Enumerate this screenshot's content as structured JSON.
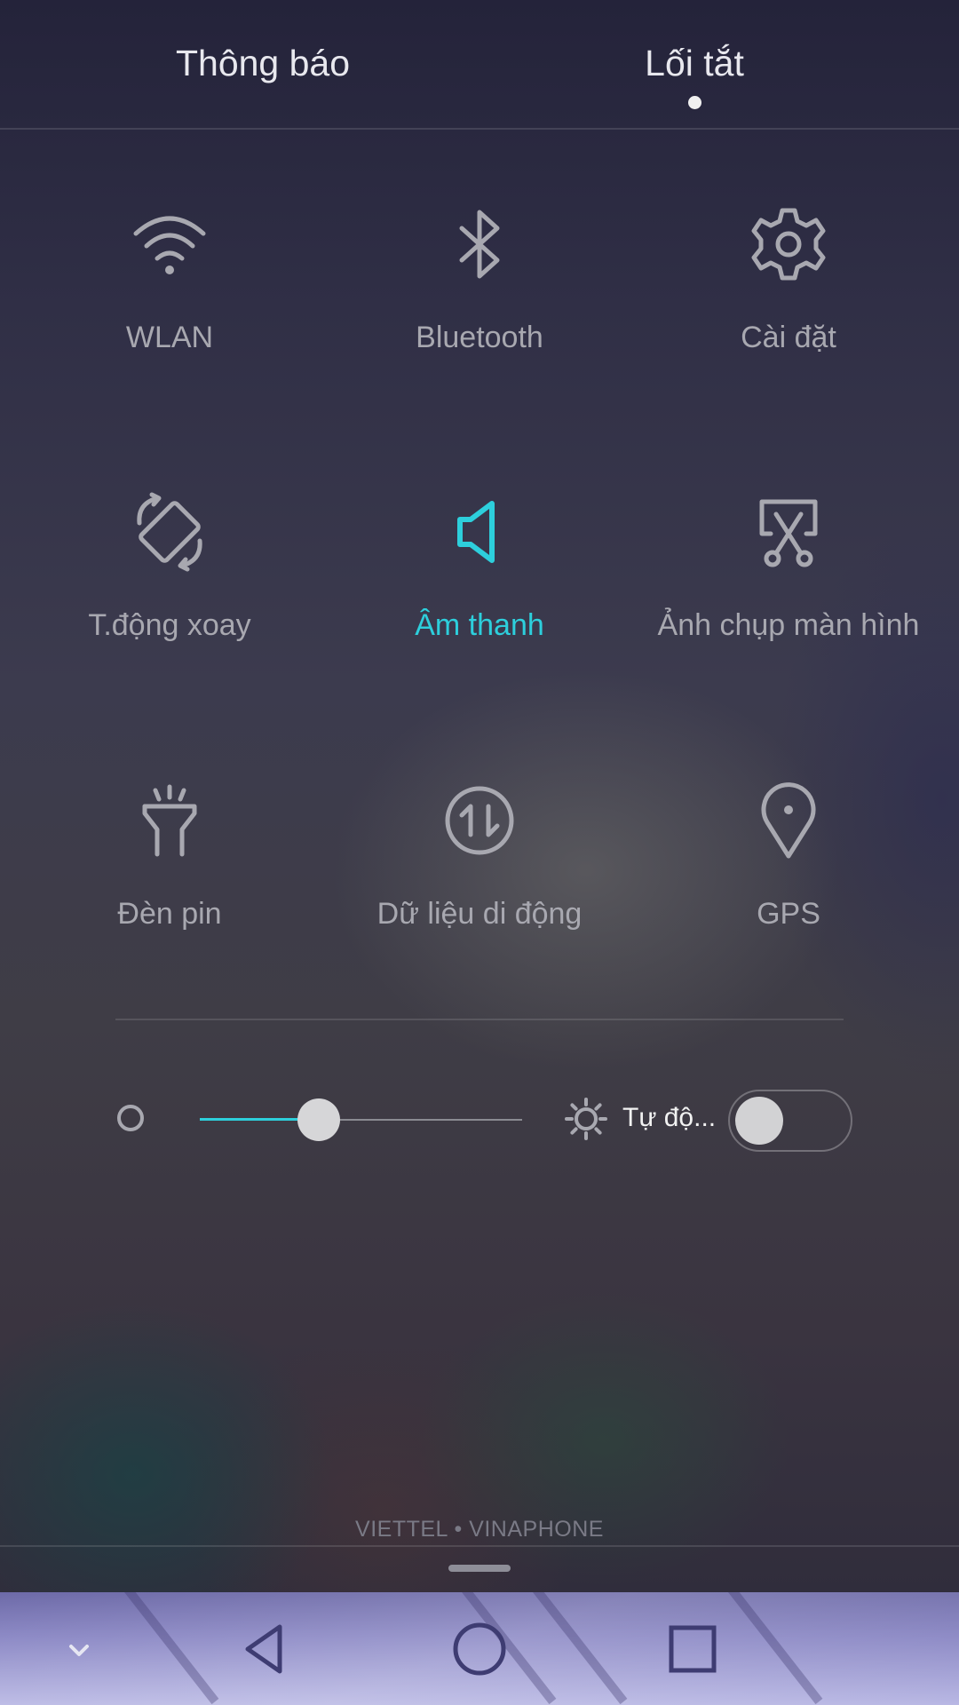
{
  "tabs": {
    "notifications_label": "Thông báo",
    "shortcuts_label": "Lối tắt",
    "active": "shortcuts"
  },
  "tiles": [
    {
      "label": "WLAN",
      "icon": "wifi-icon",
      "active": false
    },
    {
      "label": "Bluetooth",
      "icon": "bluetooth-icon",
      "active": false
    },
    {
      "label": "Cài đặt",
      "icon": "gear-icon",
      "active": false
    },
    {
      "label": "T.động xoay",
      "icon": "auto-rotate-icon",
      "active": false
    },
    {
      "label": "Âm thanh",
      "icon": "speaker-icon",
      "active": true
    },
    {
      "label": "Ảnh chụp màn hình",
      "icon": "screenshot-scissors-icon",
      "active": false
    },
    {
      "label": "Đèn pin",
      "icon": "flashlight-icon",
      "active": false
    },
    {
      "label": "Dữ liệu di động",
      "icon": "mobile-data-icon",
      "active": false
    },
    {
      "label": "GPS",
      "icon": "location-pin-icon",
      "active": false
    }
  ],
  "brightness": {
    "level": 0.37,
    "auto_label": "Tự độ...",
    "auto_enabled": false
  },
  "carrier_text": "VIETTEL • VINAPHONE",
  "colors": {
    "accent": "#2dcfdc",
    "inactive": "#a8a8b0"
  },
  "navbar": {
    "buttons": [
      "collapse-chevron-icon",
      "back-icon",
      "home-icon",
      "recents-icon"
    ]
  }
}
